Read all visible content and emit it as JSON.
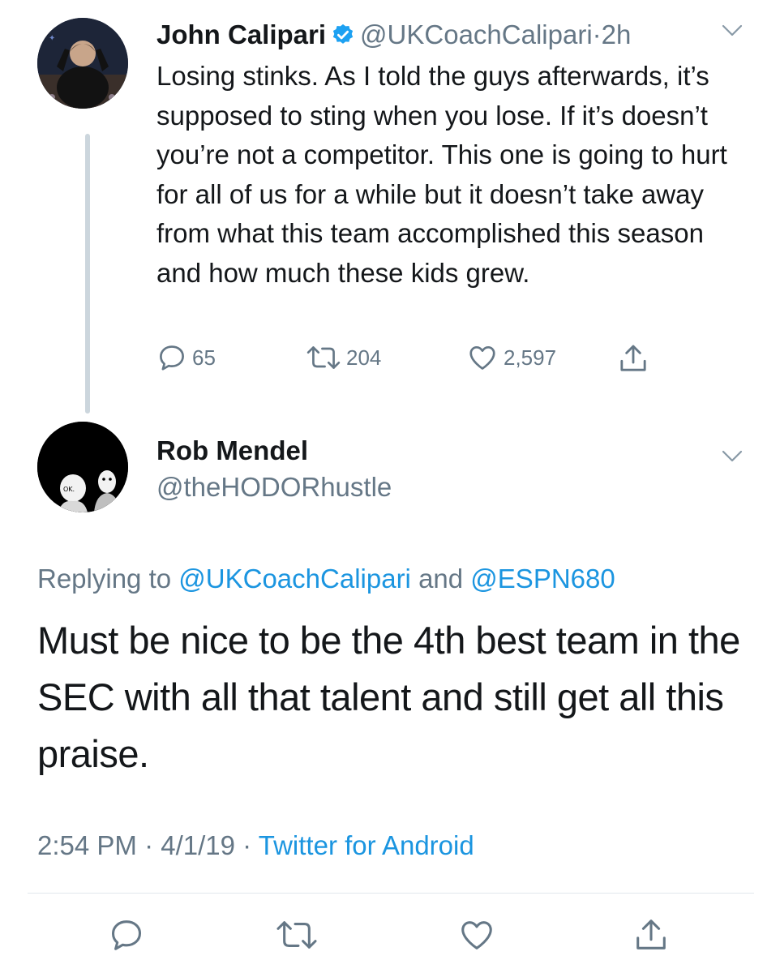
{
  "parent_tweet": {
    "author_name": "John Calipari",
    "handle": "@UKCoachCalipari",
    "separator": "·",
    "time": "2h",
    "text": "Losing stinks. As I told the guys afterwards, it’s supposed to sting when you lose. If it’s doesn’t you’re not a competitor. This one is going to hurt for all of us for a while but it doesn’t take away from what this team accomplished this season and how much these kids grew.",
    "replies": "65",
    "retweets": "204",
    "likes": "2,597",
    "icons": {
      "reply": "reply-icon",
      "retweet": "retweet-icon",
      "like": "heart-icon",
      "share": "share-icon",
      "verified": "verified-badge-icon",
      "menu": "chevron-down-icon"
    }
  },
  "reply_tweet": {
    "author_name": "Rob Mendel",
    "handle": "@theHODORhustle",
    "replying_prefix": "Replying to",
    "replying_to_1": "@UKCoachCalipari",
    "replying_and": "and",
    "replying_to_2": "@ESPN680",
    "text": "Must be nice to be the 4th best team in the SEC with all that talent and still get all this praise.",
    "time": "2:54 PM",
    "date": "4/1/19",
    "separator": "·",
    "source": "Twitter for Android"
  },
  "colors": {
    "text": "#14171a",
    "secondary": "#657786",
    "link": "#1b95e0",
    "verified": "#1da1f2",
    "divider": "#e1e8ed"
  }
}
